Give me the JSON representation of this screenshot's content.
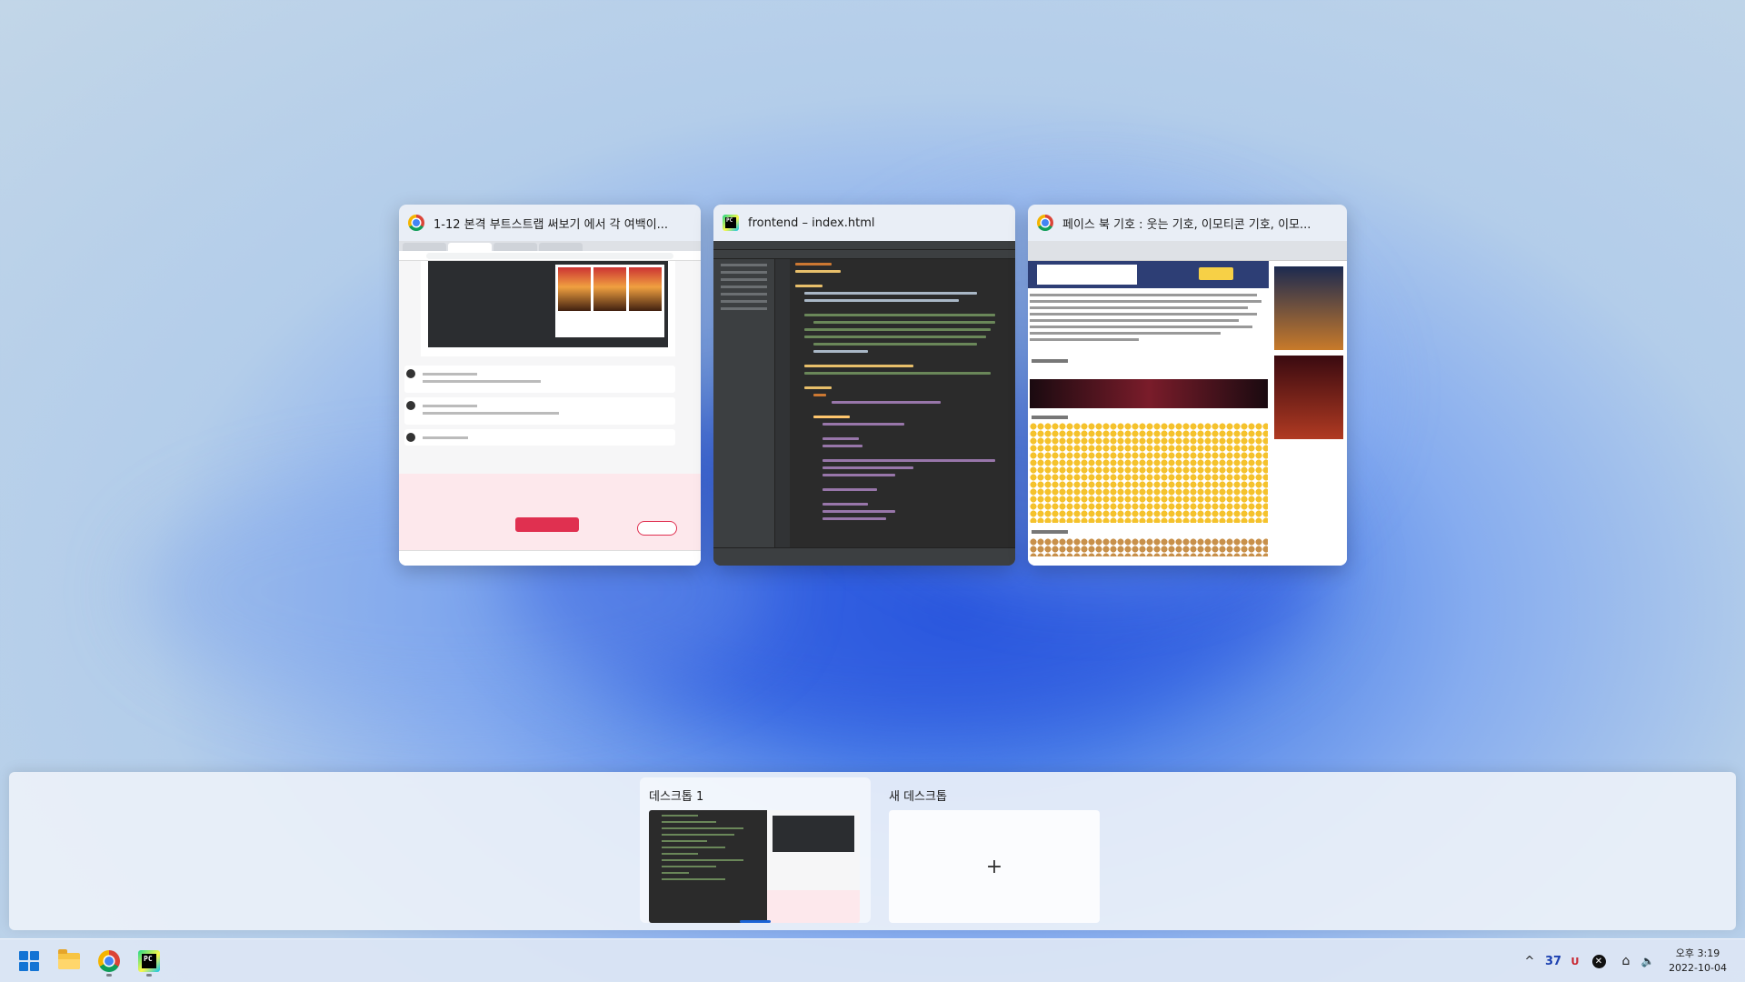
{
  "windows": [
    {
      "app": "chrome",
      "icon": "chrome-icon",
      "title": "1-12 본격 부트스트랩 써보기 에서 각 여백이..."
    },
    {
      "app": "pycharm",
      "icon": "pycharm-icon",
      "title": "frontend – index.html"
    },
    {
      "app": "chrome",
      "icon": "chrome-icon",
      "title": "페이스 북 기호 : 웃는 기호, 이모티콘 기호, 이모..."
    }
  ],
  "desktops": {
    "current_label": "데스크톱 1",
    "new_label": "새 데스크톱",
    "add_symbol": "+"
  },
  "taskbar": {
    "apps": [
      "start-icon",
      "file-explorer-icon",
      "chrome-icon",
      "pycharm-icon"
    ],
    "pycharm_badge": "PC"
  },
  "tray": {
    "chevron": "^",
    "badge": "37",
    "ime": "U",
    "x_symbol": "✕",
    "network_symbol": "⌂",
    "volume_symbol": "🔈",
    "time": "오후 3:19",
    "date": "2022-10-04"
  }
}
